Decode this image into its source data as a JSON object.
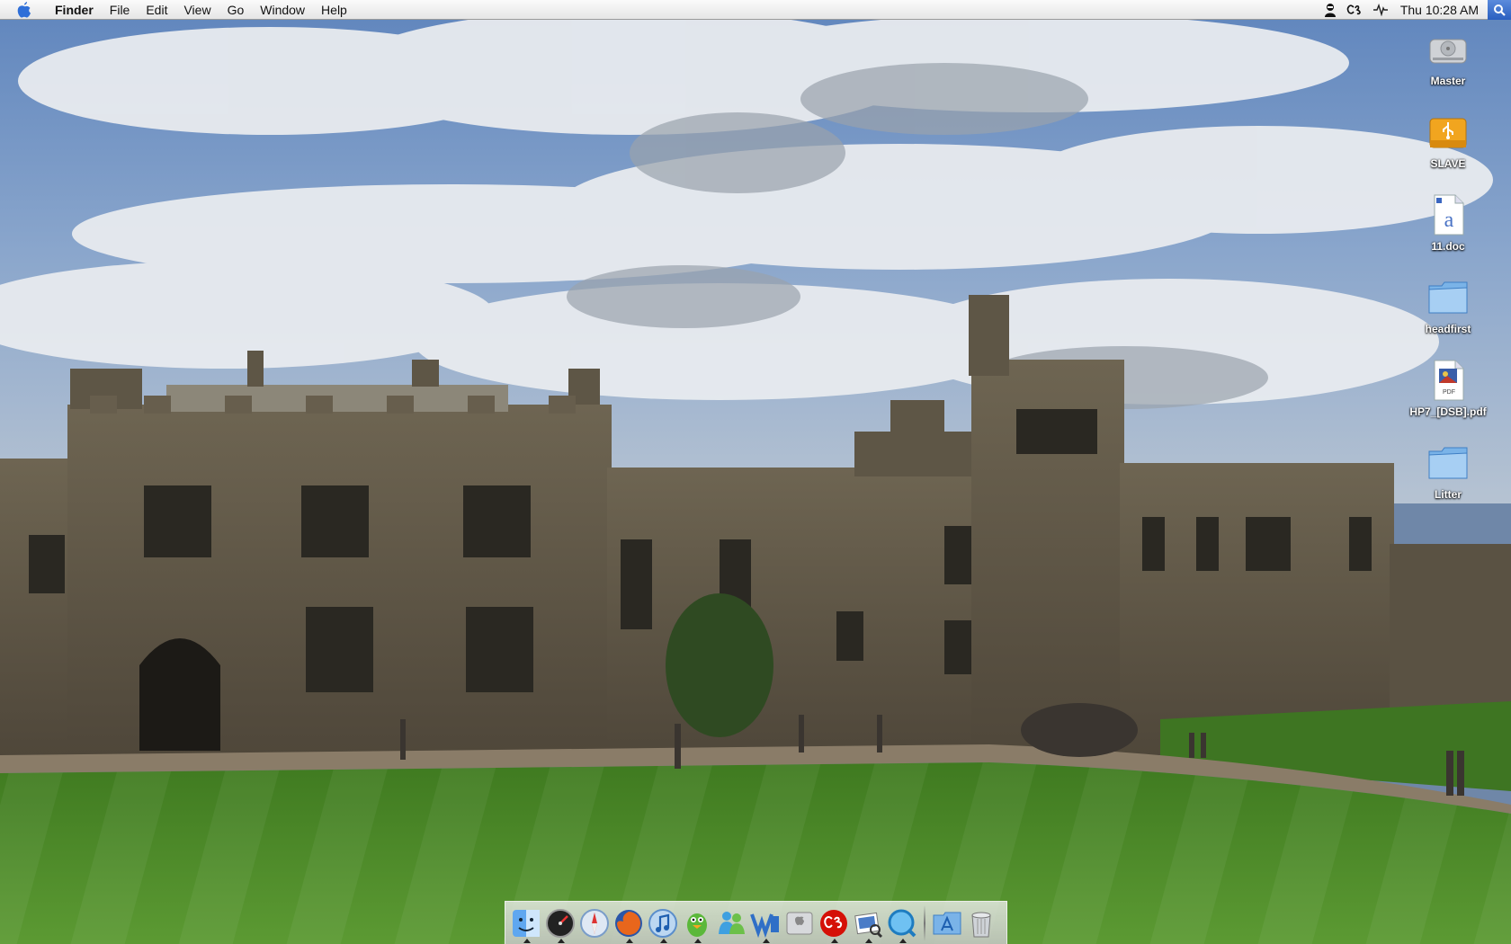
{
  "menubar": {
    "apple_icon": "apple-logo-icon",
    "app_name": "Finder",
    "menus": [
      "File",
      "Edit",
      "View",
      "Go",
      "Window",
      "Help"
    ],
    "status_icons": [
      "agent-silhouette-icon",
      "lastfm-icon",
      "sound-wave-icon"
    ],
    "clock": "Thu 10:28 AM",
    "spotlight_icon": "spotlight-search-icon"
  },
  "desktop": {
    "wallpaper": "castle-lawn-cloudy-sky",
    "icons": [
      {
        "label": "Master",
        "type": "hard-drive-icon"
      },
      {
        "label": "SLAVE",
        "type": "usb-drive-icon"
      },
      {
        "label": "11.doc",
        "type": "document-icon"
      },
      {
        "label": "headfirst",
        "type": "folder-icon"
      },
      {
        "label": "HP7_[DSB].pdf",
        "type": "pdf-icon"
      },
      {
        "label": "Litter",
        "type": "folder-icon"
      }
    ]
  },
  "dock": {
    "apps": [
      {
        "name": "finder-icon",
        "running": true
      },
      {
        "name": "dashboard-icon",
        "running": true
      },
      {
        "name": "safari-icon",
        "running": false
      },
      {
        "name": "firefox-icon",
        "running": true
      },
      {
        "name": "itunes-icon",
        "running": true
      },
      {
        "name": "adium-icon",
        "running": true
      },
      {
        "name": "messenger-icon",
        "running": false
      },
      {
        "name": "word-icon",
        "running": true
      },
      {
        "name": "system-preferences-icon",
        "running": false
      },
      {
        "name": "lastfm-app-icon",
        "running": true
      },
      {
        "name": "preview-icon",
        "running": true
      },
      {
        "name": "quicktime-icon",
        "running": true
      }
    ],
    "stacks": [
      {
        "name": "applications-folder-icon"
      },
      {
        "name": "trash-icon"
      }
    ]
  },
  "colors": {
    "menubar_bg": "#f0f0f0",
    "spotlight_blue": "#3a6fd0",
    "grass": "#4e8a2a",
    "stone": "#6e6250",
    "sky": "#7a98c4"
  }
}
